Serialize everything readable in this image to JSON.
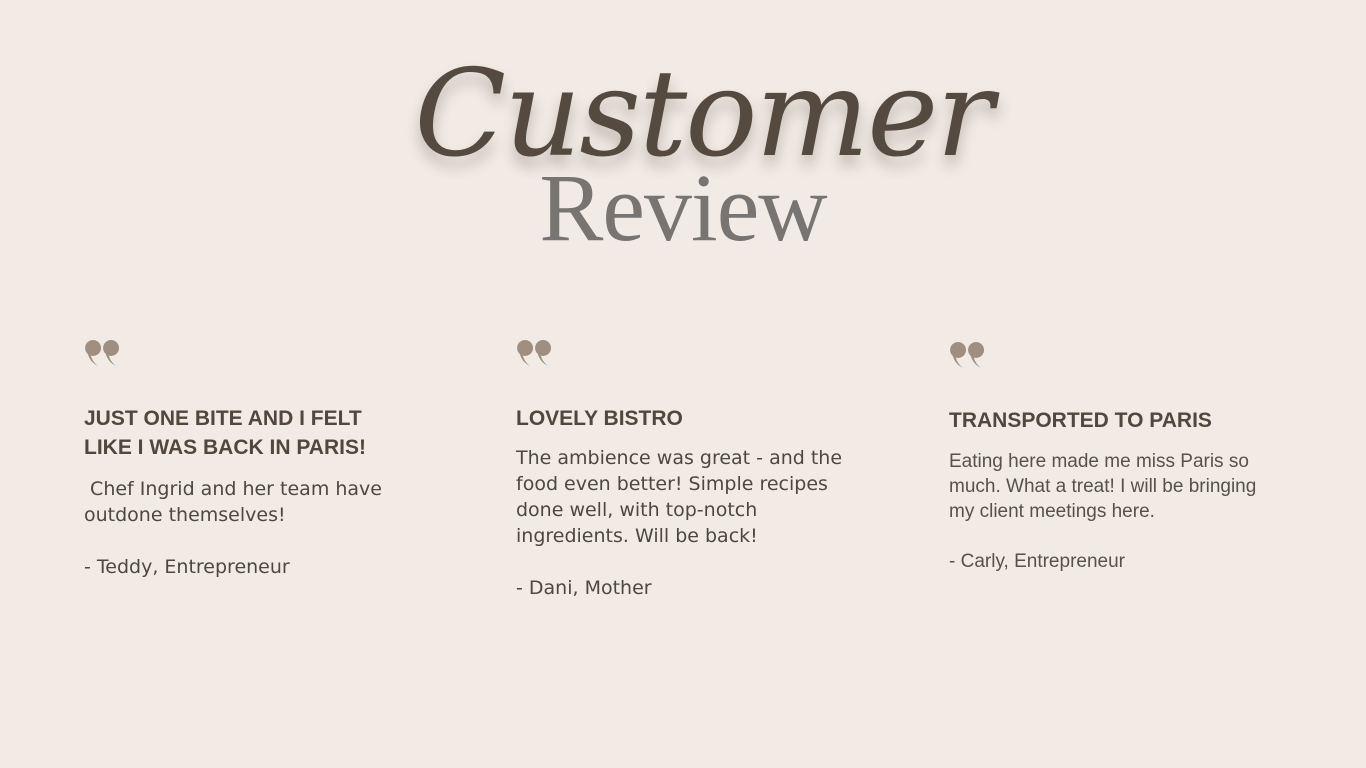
{
  "header": {
    "title_line1": "Customer",
    "title_line2": "Review"
  },
  "colors": {
    "background": "#f2ebe5",
    "quote_icon": "#a08f80",
    "heading_text": "#52473d",
    "title_dark": "#544a40",
    "title_gray": "#777472"
  },
  "reviews": [
    {
      "icon": "quote-icon",
      "heading": "JUST ONE BITE AND I FELT LIKE I WAS BACK IN PARIS!",
      "body": " Chef Ingrid and her team have outdone themselves!",
      "author": "- Teddy, Entrepreneur"
    },
    {
      "icon": "quote-icon",
      "heading": "LOVELY BISTRO",
      "body": "The ambience was great - and the food even better! Simple recipes done well, with top-notch ingredients. Will be back!",
      "author": "- Dani, Mother"
    },
    {
      "icon": "quote-icon",
      "heading": "TRANSPORTED TO PARIS",
      "body": "Eating here made me miss Paris so much. What a treat! I will be bringing my client meetings here.",
      "author": "- Carly, Entrepreneur"
    }
  ]
}
